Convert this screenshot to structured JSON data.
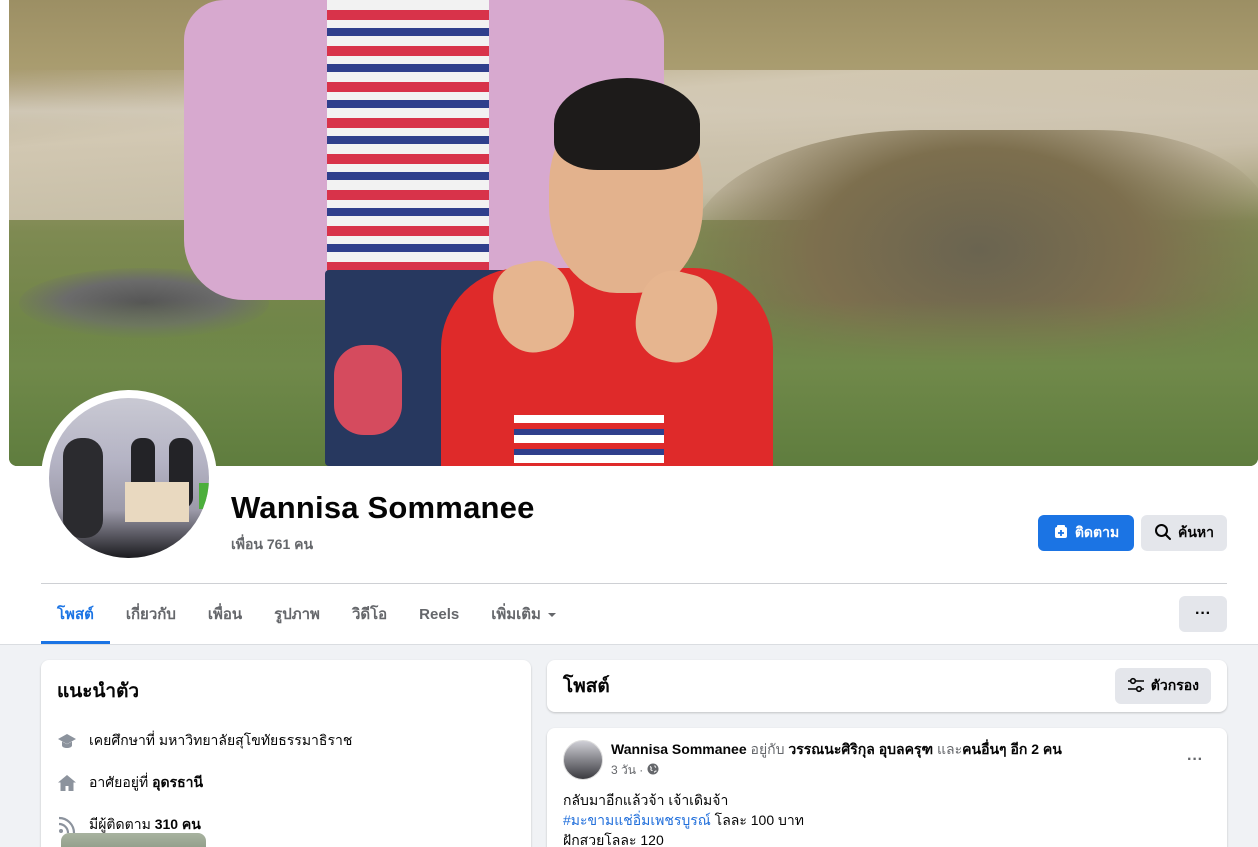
{
  "profile": {
    "name": "Wannisa Sommanee",
    "friends": "เพื่อน 761 คน"
  },
  "actions": {
    "follow_label": "ติดตาม",
    "search_label": "ค้นหา"
  },
  "tabs": [
    {
      "label": "โพสต์",
      "active": true
    },
    {
      "label": "เกี่ยวกับ"
    },
    {
      "label": "เพื่อน"
    },
    {
      "label": "รูปภาพ"
    },
    {
      "label": "วิดีโอ"
    },
    {
      "label": "Reels"
    },
    {
      "label": "เพิ่มเติม"
    }
  ],
  "more_label": "···",
  "intro": {
    "title": "แนะนำตัว",
    "items": [
      {
        "icon": "graduation-cap-icon",
        "prefix": "เคยศึกษาที่ มหาวิทยาลัยสุโขทัยธรรมาธิราช",
        "bold": ""
      },
      {
        "icon": "home-icon",
        "prefix": "อาศัยอยู่ที่ ",
        "bold": "อุดรธานี"
      },
      {
        "icon": "rss-icon",
        "prefix": "มีผู้ติดตาม ",
        "bold": "310 คน"
      }
    ]
  },
  "posts": {
    "title": "โพสต์",
    "filter_label": "ตัวกรอง",
    "item": {
      "author": "Wannisa Sommanee",
      "with_text": " อยู่กับ ",
      "tagged": "วรรณนะศิริกุล อุบลครุฑ",
      "and_text": " และ",
      "others": "คนอื่นๆ อีก 2 คน",
      "time": "3 วัน ·",
      "lines": [
        {
          "text": "กลับมาอีกแล้วจ้า เจ้าเดิมจ้า",
          "tag": ""
        },
        {
          "tag": "#มะขามแช่อิ่มเพชรบูรณ์",
          "text": " โลละ 100 บาท"
        },
        {
          "text": "ฝักสวยโลละ 120",
          "tag": ""
        }
      ]
    }
  },
  "colors": {
    "accent": "#1b74e4",
    "background": "#f0f2f5",
    "muted_text": "#65676b"
  }
}
